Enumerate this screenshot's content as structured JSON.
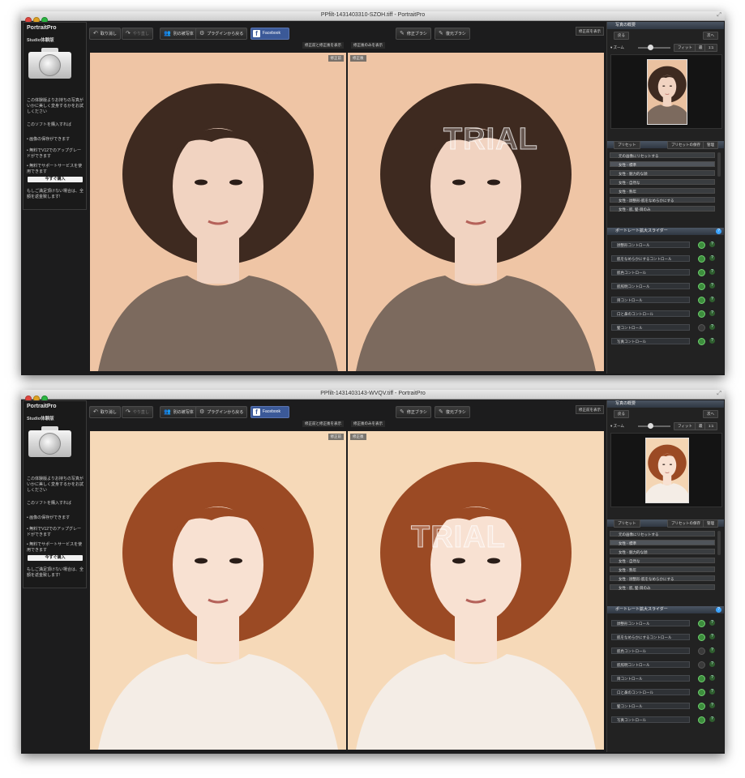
{
  "windows": [
    {
      "title": "PPfilt-1431403310-SZOH.tiff - PortraitPro",
      "trial_watermark": "TRIAL",
      "photo_palette": {
        "bg": "#efc5a5",
        "hair": "#3e2a20",
        "skin": "#f1d3c1",
        "cloth": "#7c6a5e"
      },
      "thumb_palette": {
        "bg": "#eac1a0",
        "hair": "#3e2a20",
        "skin": "#f1d3c1",
        "cloth": "#7c6a5e"
      },
      "led_on": [
        true,
        true,
        true,
        true,
        true,
        true,
        false,
        true
      ]
    },
    {
      "title": "PPfilt-1431403143-WVQV.tiff - PortraitPro",
      "trial_watermark": "TRIAL",
      "photo_palette": {
        "bg": "#f6d9b8",
        "hair": "#9b4a24",
        "skin": "#f8e1d2",
        "cloth": "#f4ede6"
      },
      "thumb_palette": {
        "bg": "#f4d5b3",
        "hair": "#9b4a24",
        "skin": "#f8e1d2",
        "cloth": "#f4ede6"
      },
      "led_on": [
        true,
        true,
        false,
        false,
        true,
        true,
        true,
        true
      ]
    }
  ],
  "left_panel": {
    "app_name": "PortraitPro",
    "edition": "Studio体験版",
    "message": "この体験版よりお持ちの写真がいかに美しく変身するかをお試しください",
    "upgrade_intro": "このソフトを購入すれば",
    "bullets": [
      "• 画像の保存ができます",
      "• 無料でV12でのアップグレードができます",
      "• 無料でサポートサービスを使用できます"
    ],
    "buy_button": "今すぐ購入",
    "guarantee": "もしご満足頂けない場合は、全額を返金致します!"
  },
  "toolbar": {
    "undo": "取り消し",
    "redo": "やり直し",
    "other_photo": "別の被写体",
    "return_plugin": "プラグインから戻る",
    "facebook": "Facebook",
    "retouch_brush": "修正ブラシ",
    "restore_brush": "復元ブラシ",
    "show_before": "修正前を表示",
    "view_before_after": "修正前と修正後を表示",
    "view_after": "修正後のみを表示"
  },
  "pane_tags": {
    "before": "修正前",
    "after": "修正後"
  },
  "right_panel": {
    "photo_overview": "写真の概要",
    "back": "戻る",
    "next": "次へ",
    "zoom_label": "ズーム",
    "fit": "フィット",
    "zoom_max": "最",
    "zoom_1to1": "1:1",
    "preset_label": "プリセット",
    "save_preset": "プリセットの保存",
    "manage": "管理",
    "presets": [
      "元の画像にリセットする",
      "女性 - 標準",
      "女性 - 魅力的な顔",
      "女性 - 自然な",
      "女性 - 熟年",
      "女性 - 顔整形-肌をなめらかにする",
      "女性 - 肌, 髪-目のみ"
    ],
    "sliders_header": "ポートレート拡大スライダー",
    "sliders": [
      "顔整形コントロール",
      "肌をなめらかにするコントロール",
      "肌色コントロール",
      "肌照明コントロール",
      "目コントロール",
      "口と鼻のコントロール",
      "髪コントロール",
      "写真コントロール"
    ]
  },
  "colors": {
    "accent_blue": "#3aa3ff",
    "facebook": "#3b5998",
    "led_green": "#3d8e3d"
  }
}
